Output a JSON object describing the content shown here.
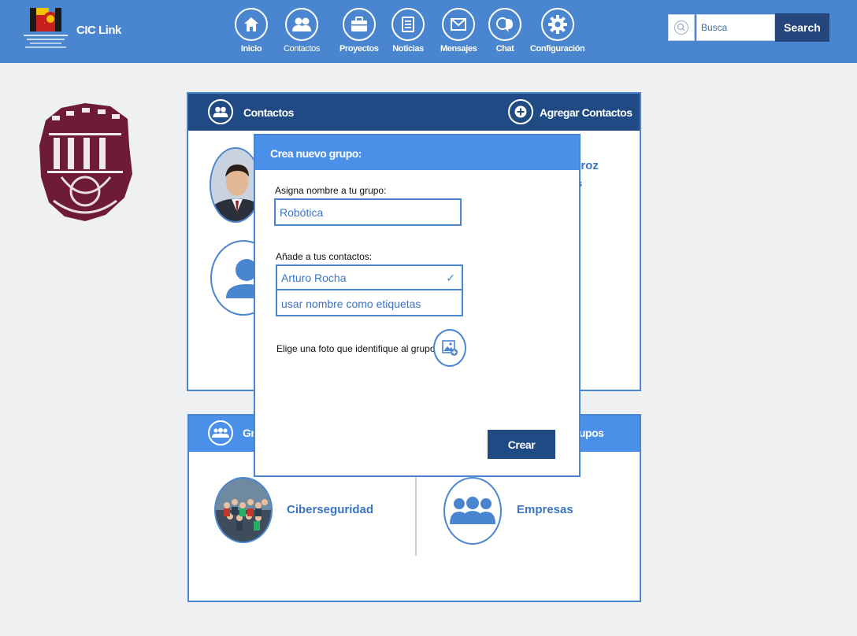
{
  "header": {
    "app_title": "CIC Link",
    "nav": [
      {
        "label": "Inicio",
        "icon": "home-icon"
      },
      {
        "label": "Contactos",
        "icon": "contacts-icon"
      },
      {
        "label": "Proyectos",
        "icon": "briefcase-icon"
      },
      {
        "label": "Noticias",
        "icon": "news-icon"
      },
      {
        "label": "Mensajes",
        "icon": "envelope-icon"
      },
      {
        "label": "Chat",
        "icon": "chat-icon"
      },
      {
        "label": "Configuración",
        "icon": "gear-icon"
      }
    ],
    "search": {
      "placeholder": "Busca",
      "button_label": "Search"
    }
  },
  "contacts_panel": {
    "title": "Contactos",
    "add_label": "Agregar Contactos",
    "partial_name": "iiroz",
    "partial_sub": "s"
  },
  "groups_panel": {
    "title_partial": "Gr",
    "title_right_partial": "upos",
    "groups": [
      {
        "name": "Ciberseguridad",
        "icon": "group-photo"
      },
      {
        "name": "Empresas",
        "icon": "group-people-icon"
      }
    ]
  },
  "modal": {
    "title": "Crea nuevo grupo:",
    "name_label": "Asigna nombre a tu grupo:",
    "name_value": "Robótica",
    "contacts_label": "Añade a tus contactos:",
    "contacts_options": [
      "Arturo Rocha",
      "usar nombre como etiquetas"
    ],
    "photo_label": "Elige una foto que identifique al grupo:",
    "create_label": "Crear"
  },
  "colors": {
    "topbar": "#4a86cf",
    "dark_blue": "#1f4a84",
    "accent_blue": "#4a90e8",
    "link_blue": "#3a74c4",
    "ipn_maroon": "#6e1b35"
  }
}
